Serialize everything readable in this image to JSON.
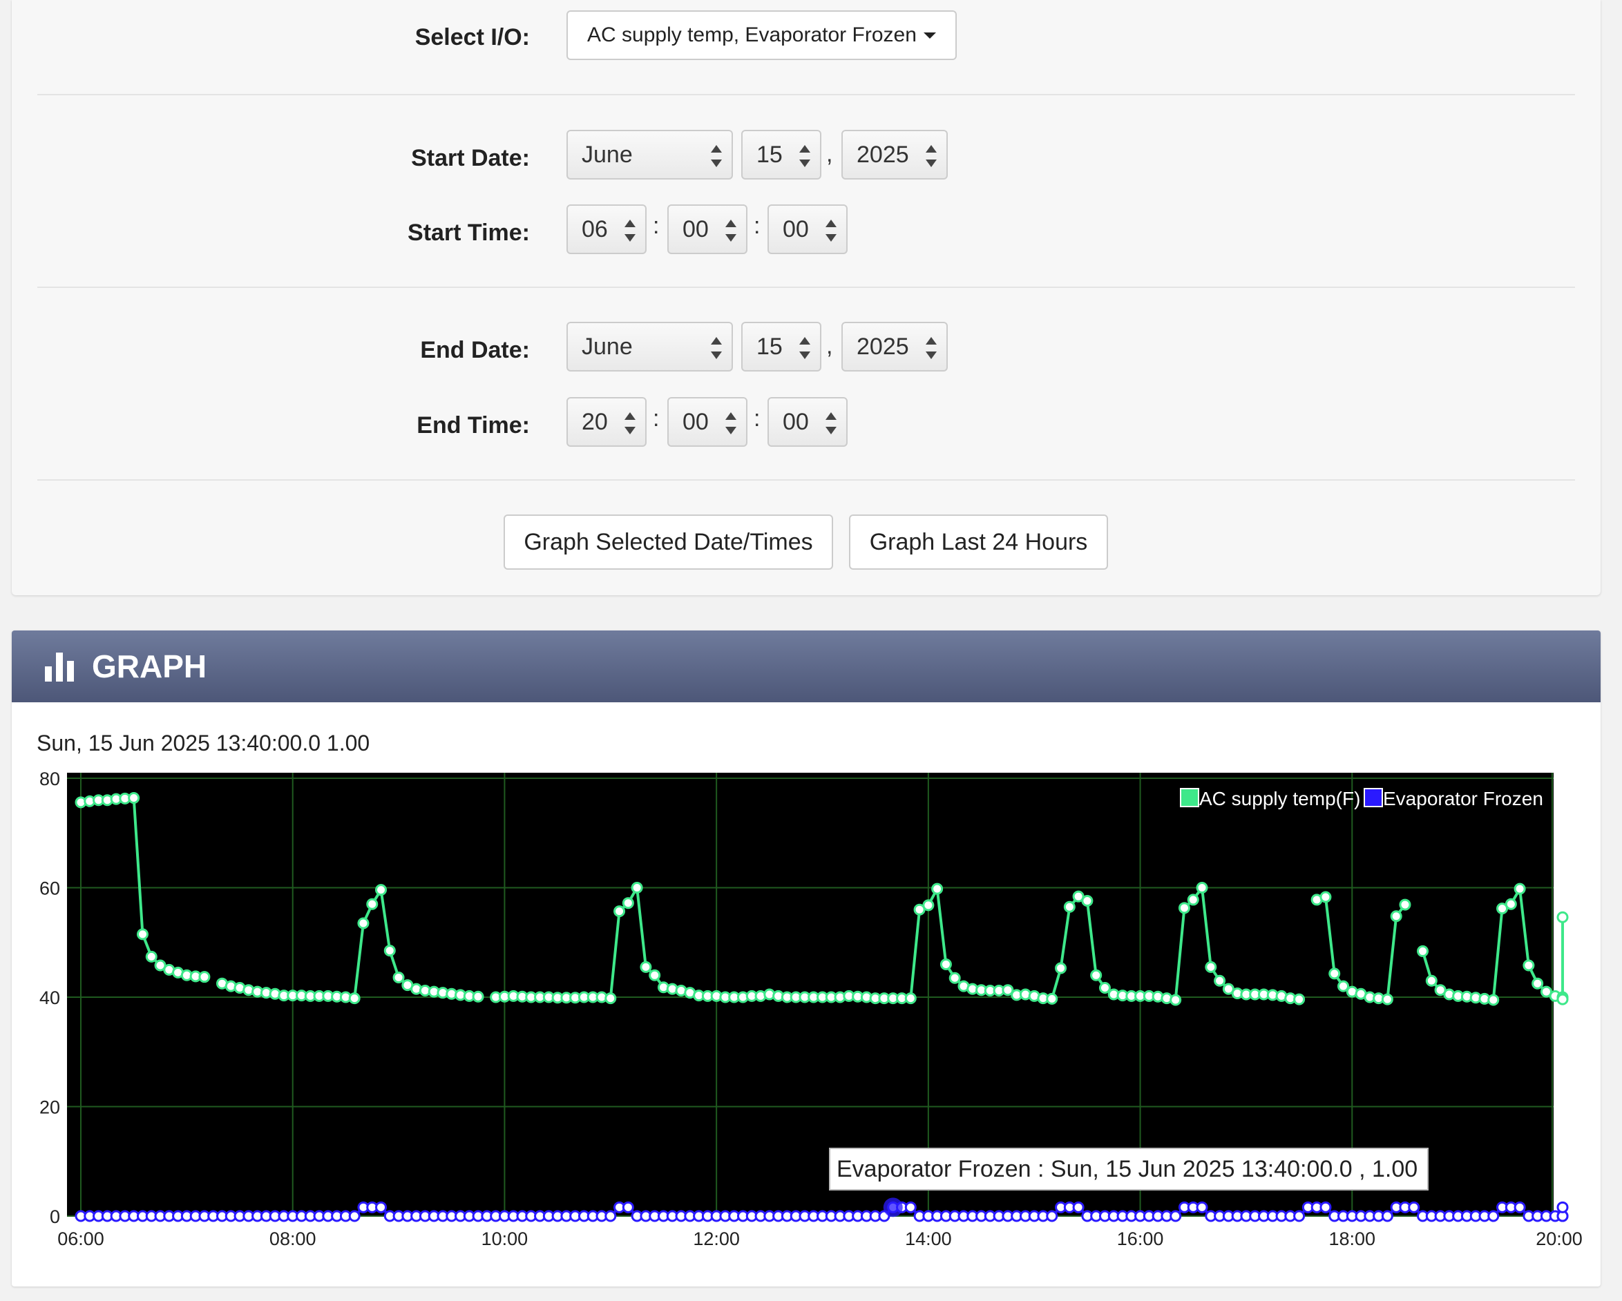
{
  "form": {
    "select_io_label": "Select I/O:",
    "select_io_value": "AC supply temp, Evaporator Frozen",
    "start_date_label": "Start Date:",
    "start_time_label": "Start Time:",
    "end_date_label": "End Date:",
    "end_time_label": "End Time:",
    "start": {
      "month": "June",
      "day": "15",
      "year": "2025",
      "hour": "06",
      "minute": "00",
      "second": "00"
    },
    "end": {
      "month": "June",
      "day": "15",
      "year": "2025",
      "hour": "20",
      "minute": "00",
      "second": "00"
    },
    "comma": ",",
    "colon": ":",
    "graph_selected_button": "Graph Selected Date/Times",
    "graph_last24_button": "Graph Last 24 Hours"
  },
  "graph": {
    "title": "GRAPH",
    "icon": "bar-chart-icon",
    "hover_readout": "Sun, 15 Jun 2025 13:40:00.0 1.00",
    "tooltip": "Evaporator Frozen : Sun, 15 Jun 2025 13:40:00.0 , 1.00"
  },
  "colors": {
    "header": "#5b6585",
    "plot_bg": "#000000",
    "grid": "#1f5a1f",
    "series_green": "#3ee88a",
    "series_blue": "#2a1aff"
  },
  "chart_data": {
    "type": "line",
    "x_range": [
      "06:00",
      "20:00"
    ],
    "x_ticks": [
      "06:00",
      "08:00",
      "10:00",
      "12:00",
      "14:00",
      "16:00",
      "18:00",
      "20:00"
    ],
    "y_ticks": [
      0,
      20,
      40,
      60,
      80
    ],
    "ylim": [
      0,
      80
    ],
    "grid": true,
    "legend_position": "top-right",
    "series": [
      {
        "name": "AC supply temp(F)",
        "color": "#3ee88a",
        "segments": [
          [
            [
              "06:00",
              75.6
            ],
            [
              "06:05",
              75.8
            ],
            [
              "06:10",
              76
            ],
            [
              "06:15",
              76
            ],
            [
              "06:20",
              76.2
            ],
            [
              "06:25",
              76.3
            ],
            [
              "06:30",
              76.4
            ],
            [
              "06:35",
              51.5
            ],
            [
              "06:40",
              47.4
            ],
            [
              "06:45",
              45.8
            ],
            [
              "06:50",
              45
            ],
            [
              "06:55",
              44.5
            ],
            [
              "07:00",
              44
            ],
            [
              "07:05",
              43.8
            ],
            [
              "07:10",
              43.7
            ]
          ],
          [
            [
              "07:20",
              42.5
            ],
            [
              "07:25",
              42
            ],
            [
              "07:30",
              41.7
            ],
            [
              "07:35",
              41.3
            ],
            [
              "07:40",
              41
            ],
            [
              "07:45",
              40.8
            ],
            [
              "07:50",
              40.6
            ]
          ],
          [
            [
              "07:55",
              40.3
            ],
            [
              "08:00",
              40.3
            ],
            [
              "08:05",
              40.3
            ],
            [
              "08:10",
              40.2
            ],
            [
              "08:15",
              40.2
            ],
            [
              "08:20",
              40.2
            ],
            [
              "08:25",
              40.1
            ],
            [
              "08:30",
              40
            ],
            [
              "08:35",
              39.8
            ],
            [
              "08:40",
              53.5
            ],
            [
              "08:45",
              57
            ],
            [
              "08:50",
              59.6
            ],
            [
              "08:55",
              48.5
            ],
            [
              "09:00",
              43.6
            ],
            [
              "09:05",
              42.2
            ],
            [
              "09:10",
              41.5
            ],
            [
              "09:15",
              41.2
            ],
            [
              "09:20",
              41
            ],
            [
              "09:25",
              40.8
            ],
            [
              "09:30",
              40.6
            ],
            [
              "09:35",
              40.4
            ],
            [
              "09:40",
              40.2
            ],
            [
              "09:45",
              40.1
            ]
          ],
          [
            [
              "09:55",
              40
            ],
            [
              "10:00",
              40.1
            ],
            [
              "10:05",
              40.2
            ],
            [
              "10:10",
              40.1
            ],
            [
              "10:15",
              40
            ],
            [
              "10:20",
              40
            ],
            [
              "10:25",
              40
            ],
            [
              "10:30",
              39.9
            ],
            [
              "10:35",
              39.9
            ],
            [
              "10:40",
              39.9
            ],
            [
              "10:45",
              40
            ],
            [
              "10:50",
              40
            ],
            [
              "10:55",
              40
            ],
            [
              "11:00",
              39.8
            ],
            [
              "11:05",
              55.7
            ],
            [
              "11:10",
              57.2
            ],
            [
              "11:15",
              60
            ],
            [
              "11:20",
              45.5
            ],
            [
              "11:25",
              44
            ],
            [
              "11:30",
              41.8
            ],
            [
              "11:35",
              41.5
            ],
            [
              "11:40",
              41.2
            ],
            [
              "11:45",
              40.8
            ],
            [
              "11:50",
              40.3
            ],
            [
              "11:55",
              40.2
            ],
            [
              "12:00",
              40.2
            ],
            [
              "12:05",
              40
            ],
            [
              "12:10",
              40
            ],
            [
              "12:15",
              40
            ],
            [
              "12:20",
              40.2
            ],
            [
              "12:25",
              40.2
            ],
            [
              "12:30",
              40.5
            ],
            [
              "12:35",
              40.2
            ],
            [
              "12:40",
              40
            ],
            [
              "12:45",
              40
            ],
            [
              "12:50",
              40
            ],
            [
              "12:55",
              40
            ],
            [
              "13:00",
              40
            ],
            [
              "13:05",
              40
            ],
            [
              "13:10",
              40
            ],
            [
              "13:15",
              40.2
            ],
            [
              "13:20",
              40.1
            ],
            [
              "13:25",
              40
            ],
            [
              "13:30",
              39.8
            ],
            [
              "13:35",
              39.8
            ],
            [
              "13:40",
              39.8
            ],
            [
              "13:45",
              39.8
            ],
            [
              "13:50",
              39.8
            ],
            [
              "13:55",
              56
            ],
            [
              "14:00",
              56.8
            ],
            [
              "14:05",
              59.8
            ],
            [
              "14:10",
              46
            ],
            [
              "14:15",
              43.5
            ],
            [
              "14:20",
              42
            ],
            [
              "14:25",
              41.5
            ],
            [
              "14:30",
              41.3
            ],
            [
              "14:35",
              41.2
            ],
            [
              "14:40",
              41.2
            ],
            [
              "14:45",
              41.3
            ],
            [
              "14:50",
              40.4
            ],
            [
              "14:55",
              40.5
            ],
            [
              "15:00",
              40.2
            ],
            [
              "15:05",
              39.8
            ],
            [
              "15:10",
              39.7
            ],
            [
              "15:15",
              45.3
            ],
            [
              "15:20",
              56.5
            ],
            [
              "15:25",
              58.4
            ],
            [
              "15:30",
              57.6
            ],
            [
              "15:35",
              44
            ],
            [
              "15:40",
              41.7
            ],
            [
              "15:45",
              40.5
            ],
            [
              "15:50",
              40.3
            ],
            [
              "15:55",
              40.2
            ],
            [
              "16:00",
              40.2
            ],
            [
              "16:05",
              40.2
            ],
            [
              "16:10",
              40.1
            ],
            [
              "16:15",
              39.8
            ],
            [
              "16:20",
              39.5
            ],
            [
              "16:25",
              56.3
            ],
            [
              "16:30",
              57.8
            ],
            [
              "16:35",
              60
            ],
            [
              "16:40",
              45.5
            ],
            [
              "16:45",
              43
            ],
            [
              "16:50",
              41.5
            ],
            [
              "16:55",
              40.7
            ],
            [
              "17:00",
              40.5
            ],
            [
              "17:05",
              40.5
            ],
            [
              "17:10",
              40.5
            ],
            [
              "17:15",
              40.4
            ],
            [
              "17:20",
              40.2
            ],
            [
              "17:25",
              39.8
            ],
            [
              "17:30",
              39.6
            ]
          ],
          [
            [
              "17:40",
              57.8
            ],
            [
              "17:45",
              58.3
            ],
            [
              "17:50",
              44.3
            ],
            [
              "17:55",
              42
            ],
            [
              "18:00",
              41
            ],
            [
              "18:05",
              40.6
            ],
            [
              "18:10",
              40
            ],
            [
              "18:15",
              39.8
            ],
            [
              "18:20",
              39.6
            ],
            [
              "18:25",
              54.8
            ],
            [
              "18:30",
              56.9
            ]
          ],
          [
            [
              "18:40",
              48.4
            ],
            [
              "18:45",
              43
            ],
            [
              "18:50",
              41.3
            ],
            [
              "18:55",
              40.5
            ],
            [
              "19:00",
              40.2
            ],
            [
              "19:05",
              40.1
            ],
            [
              "19:10",
              39.9
            ],
            [
              "19:15",
              39.7
            ],
            [
              "19:20",
              39.5
            ],
            [
              "19:25",
              56.2
            ],
            [
              "19:30",
              57
            ],
            [
              "19:35",
              59.8
            ],
            [
              "19:40",
              45.8
            ],
            [
              "19:45",
              42.5
            ],
            [
              "19:50",
              41
            ],
            [
              "19:55",
              40.2
            ],
            [
              "20:00",
              40
            ],
            [
              "20:05",
              39.8
            ],
            [
              "20:10",
              39.6
            ],
            [
              "20:15",
              54.6
            ]
          ]
        ]
      },
      {
        "name": "Evaporator Frozen",
        "color": "#2a1aff",
        "high_intervals": [
          [
            "08:40",
            "08:50"
          ],
          [
            "11:05",
            "11:10"
          ],
          [
            "13:40",
            "13:50"
          ],
          [
            "15:15",
            "15:25"
          ],
          [
            "16:25",
            "16:35"
          ],
          [
            "17:35",
            "17:45"
          ],
          [
            "18:25",
            "18:35"
          ],
          [
            "19:25",
            "19:35"
          ],
          [
            "20:15",
            "20:15"
          ]
        ],
        "step_minutes": 5,
        "start": "06:00",
        "end": "20:15"
      }
    ]
  }
}
